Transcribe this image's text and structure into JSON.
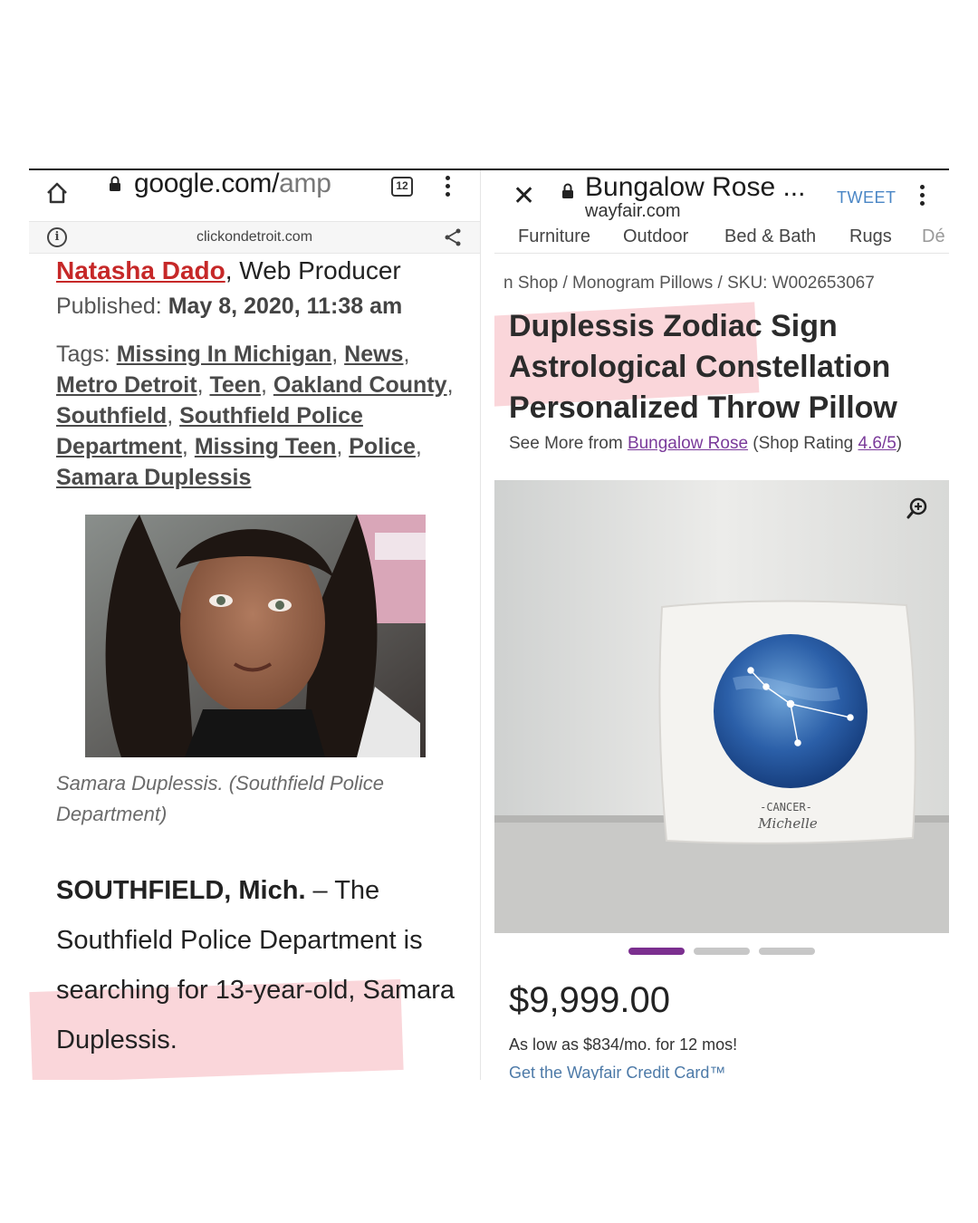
{
  "left": {
    "url_main": "google.com/",
    "url_dim": "amp",
    "tab_count": "12",
    "amp_domain": "clickondetroit.com",
    "author_name": "Natasha Dado",
    "author_role": ", Web Producer",
    "published_label": "Published:",
    "published_date": "May 8, 2020, 11:38 am",
    "tags_label": "Tags:",
    "tags": [
      "Missing In Michigan",
      "News",
      "Metro Detroit",
      "Teen",
      "Oakland County",
      "Southfield",
      "Southfield Police Department",
      "Missing Teen",
      "Police",
      "Samara Duplessis"
    ],
    "caption": "Samara Duplessis. (Southfield Police Department)",
    "dateline": "SOUTHFIELD, Mich.",
    "body": " – The Southfield Police Department is searching for 13-year-old, Samara Duplessis."
  },
  "right": {
    "site_title": "Bungalow Rose ...",
    "site_domain": "wayfair.com",
    "tweet_label": "TWEET",
    "nav": [
      "Furniture",
      "Outdoor",
      "Bed & Bath",
      "Rugs",
      "Dé"
    ],
    "breadcrumb": "n Shop / Monogram Pillows / SKU: W002653067",
    "product_title": "Duplessis Zodiac Sign Astrological Constellation Personalized Throw Pillow",
    "see_more_prefix": "See More from ",
    "see_more_brand": "Bungalow Rose",
    "shop_rating_prefix": " (Shop Rating ",
    "shop_rating": "4.6/5",
    "shop_rating_suffix": ")",
    "pillow_sign": "-CANCER-",
    "pillow_name": "Michelle",
    "price": "$9,999.00",
    "financing": "As low as $834/mo. for 12 mos!",
    "card_link": "Get the Wayfair Credit Card™"
  }
}
